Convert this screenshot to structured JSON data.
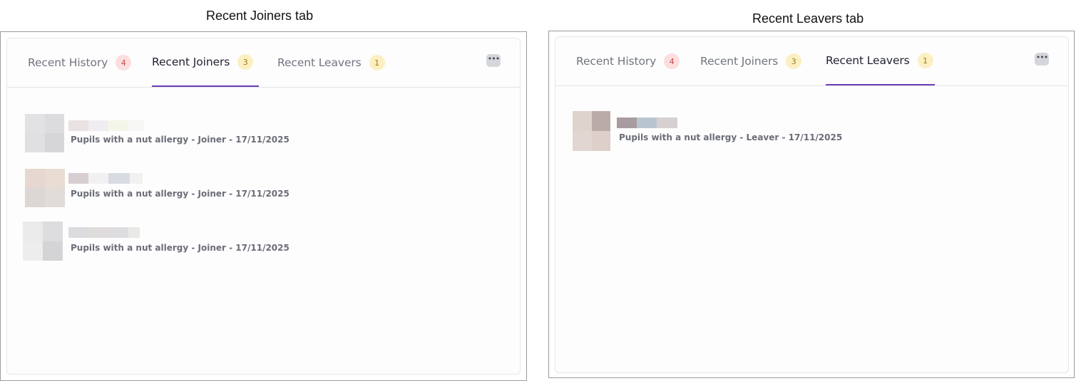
{
  "panels": [
    {
      "caption": "Recent Joiners tab",
      "tabs": [
        {
          "label": "Recent History",
          "count": "4"
        },
        {
          "label": "Recent Joiners",
          "count": "3"
        },
        {
          "label": "Recent Leavers",
          "count": "1"
        }
      ],
      "active_tab": "Recent Joiners",
      "more_icon": "ellipsis-icon",
      "entries": [
        {
          "description": "Pupils with a nut allergy - Joiner - 17/11/2025"
        },
        {
          "description": "Pupils with a nut allergy - Joiner - 17/11/2025"
        },
        {
          "description": "Pupils with a nut allergy - Joiner - 17/11/2025"
        }
      ]
    },
    {
      "caption": "Recent Leavers tab",
      "tabs": [
        {
          "label": "Recent History",
          "count": "4"
        },
        {
          "label": "Recent Joiners",
          "count": "3"
        },
        {
          "label": "Recent Leavers",
          "count": "1"
        }
      ],
      "active_tab": "Recent Leavers",
      "more_icon": "ellipsis-icon",
      "entries": [
        {
          "description": "Pupils with a nut allergy - Leaver - 17/11/2025"
        }
      ]
    }
  ],
  "colors": {
    "active_tab_underline": "#6a3fb4",
    "history_badge_bg": "#fcdede",
    "count_badge_bg": "#fcefc2"
  }
}
